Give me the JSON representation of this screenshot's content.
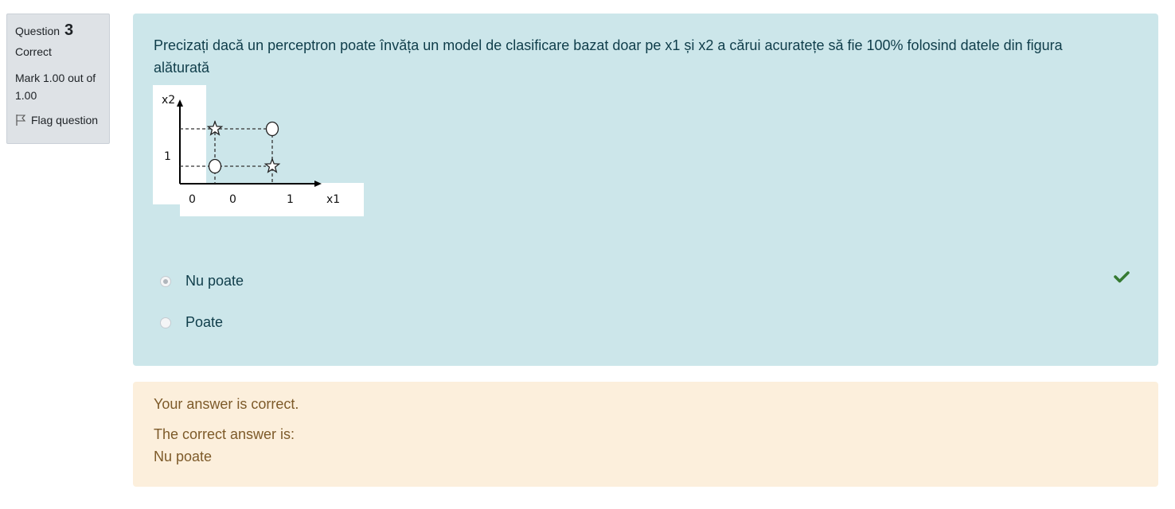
{
  "question_info": {
    "label": "Question",
    "number": "3",
    "state": "Correct",
    "grade": "Mark 1.00 out of 1.00",
    "flag_label": "Flag question"
  },
  "question": {
    "text": "Precizați dacă un perceptron poate învăța un model de clasificare bazat doar pe x1 și x2 a cărui acuratețe să fie 100% folosind datele din figura alăturată",
    "figure": {
      "y_axis_label": "x2",
      "x_axis_label": "x1",
      "y_tick": "1",
      "origin_label": "0",
      "x_ticks": [
        "0",
        "1"
      ],
      "points": [
        {
          "x": 0,
          "y": 0,
          "marker": "circle"
        },
        {
          "x": 1,
          "y": 1,
          "marker": "circle"
        },
        {
          "x": 0,
          "y": 1,
          "marker": "star"
        },
        {
          "x": 1,
          "y": 0,
          "marker": "star"
        }
      ]
    },
    "answers": [
      {
        "label": "Nu poate",
        "selected": true,
        "correct": true
      },
      {
        "label": "Poate",
        "selected": false,
        "correct": false
      }
    ]
  },
  "feedback": {
    "result": "Your answer is correct.",
    "correct_intro": "The correct answer is:",
    "correct_answer": "Nu poate"
  },
  "colors": {
    "formulation_bg": "#cce6ea",
    "feedback_bg": "#fcefdc",
    "info_bg": "#dee2e6",
    "check_green": "#357a32"
  }
}
